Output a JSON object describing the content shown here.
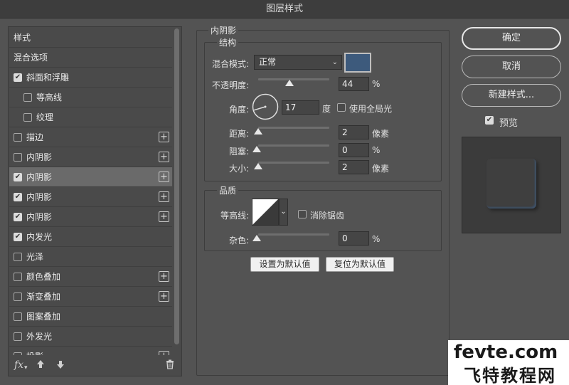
{
  "window": {
    "title": "图层样式"
  },
  "styles_list": {
    "items": [
      {
        "label": "样式",
        "checkbox": false,
        "checked": false,
        "indent": 0,
        "plus": false,
        "selected": false
      },
      {
        "label": "混合选项",
        "checkbox": false,
        "checked": false,
        "indent": 0,
        "plus": false,
        "selected": false
      },
      {
        "label": "斜面和浮雕",
        "checkbox": true,
        "checked": true,
        "indent": 0,
        "plus": false,
        "selected": false
      },
      {
        "label": "等高线",
        "checkbox": true,
        "checked": false,
        "indent": 1,
        "plus": false,
        "selected": false
      },
      {
        "label": "纹理",
        "checkbox": true,
        "checked": false,
        "indent": 1,
        "plus": false,
        "selected": false
      },
      {
        "label": "描边",
        "checkbox": true,
        "checked": false,
        "indent": 0,
        "plus": true,
        "selected": false
      },
      {
        "label": "内阴影",
        "checkbox": true,
        "checked": false,
        "indent": 0,
        "plus": true,
        "selected": false
      },
      {
        "label": "内阴影",
        "checkbox": true,
        "checked": true,
        "indent": 0,
        "plus": true,
        "selected": true
      },
      {
        "label": "内阴影",
        "checkbox": true,
        "checked": true,
        "indent": 0,
        "plus": true,
        "selected": false
      },
      {
        "label": "内阴影",
        "checkbox": true,
        "checked": true,
        "indent": 0,
        "plus": true,
        "selected": false
      },
      {
        "label": "内发光",
        "checkbox": true,
        "checked": true,
        "indent": 0,
        "plus": false,
        "selected": false
      },
      {
        "label": "光泽",
        "checkbox": true,
        "checked": false,
        "indent": 0,
        "plus": false,
        "selected": false
      },
      {
        "label": "颜色叠加",
        "checkbox": true,
        "checked": false,
        "indent": 0,
        "plus": true,
        "selected": false
      },
      {
        "label": "渐变叠加",
        "checkbox": true,
        "checked": false,
        "indent": 0,
        "plus": true,
        "selected": false
      },
      {
        "label": "图案叠加",
        "checkbox": true,
        "checked": false,
        "indent": 0,
        "plus": false,
        "selected": false
      },
      {
        "label": "外发光",
        "checkbox": true,
        "checked": false,
        "indent": 0,
        "plus": false,
        "selected": false
      },
      {
        "label": "投影",
        "checkbox": true,
        "checked": false,
        "indent": 0,
        "plus": true,
        "selected": false
      }
    ],
    "footer": {
      "fx": "fx",
      "up_icon": "arrow-up-icon",
      "down_icon": "arrow-down-icon",
      "trash_icon": "trash-icon"
    }
  },
  "inner_shadow": {
    "title": "内阴影",
    "structure": {
      "title": "结构",
      "blend_mode_label": "混合模式:",
      "blend_mode_value": "正常",
      "shadow_color": "#3d5a7c",
      "opacity_label": "不透明度:",
      "opacity_value": "44",
      "opacity_unit": "%",
      "opacity_fraction": 0.44,
      "angle_label": "角度:",
      "angle_value": "17",
      "angle_unit": "度",
      "global_light_label": "使用全局光",
      "global_light_checked": false,
      "distance_label": "距离:",
      "distance_value": "2",
      "distance_unit": "像素",
      "choke_label": "阻塞:",
      "choke_value": "0",
      "choke_unit": "%",
      "size_label": "大小:",
      "size_value": "2",
      "size_unit": "像素"
    },
    "quality": {
      "title": "品质",
      "contour_label": "等高线:",
      "antialias_label": "消除锯齿",
      "antialias_checked": false,
      "noise_label": "杂色:",
      "noise_value": "0",
      "noise_unit": "%"
    },
    "set_default_label": "设置为默认值",
    "reset_default_label": "复位为默认值"
  },
  "actions": {
    "ok_label": "确定",
    "cancel_label": "取消",
    "new_style_label": "新建样式...",
    "preview_label": "预览",
    "preview_checked": true
  },
  "watermark": {
    "line1": "fevte.com",
    "line2": "飞特教程网"
  }
}
